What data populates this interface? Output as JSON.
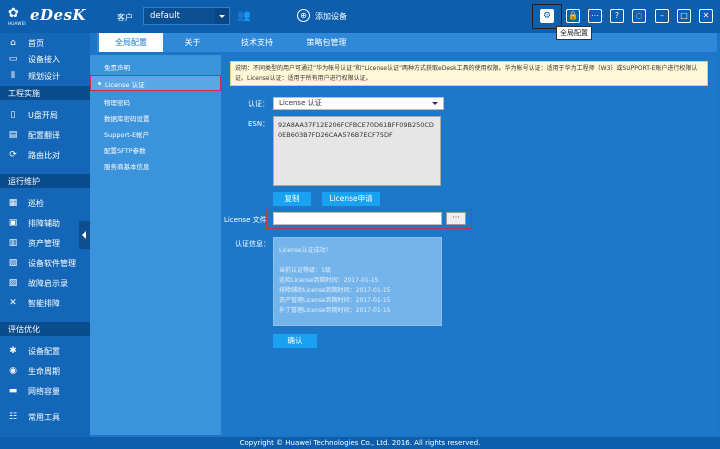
{
  "header": {
    "brand_sub": "HUAWEI",
    "brand": "eDesK",
    "customer_label": "客户",
    "customer_value": "default",
    "add_device": "添加设备",
    "tooltip": "全局配置",
    "help_label": "?"
  },
  "sidebar": {
    "items": [
      {
        "label": "首页",
        "icon": "home-icon"
      },
      {
        "label": "设备接入",
        "icon": "device-access-icon"
      },
      {
        "label": "规划设计",
        "icon": "plan-icon"
      }
    ],
    "sections": [
      "工程实施",
      "运行维护",
      "评估优化"
    ],
    "impl_items": [
      "U盘开局",
      "配置翻译",
      "路由比对"
    ],
    "ops_items": [
      "巡检",
      "排障辅助",
      "资产管理",
      "设备软件管理",
      "故障启示录",
      "智能排障"
    ],
    "opt_items": [
      "设备配置",
      "生命周期",
      "网络容量"
    ],
    "tools": "常用工具"
  },
  "tabs": [
    "全局配置",
    "关于",
    "技术支持",
    "策略包管理"
  ],
  "submenu": [
    "免责声明",
    "License 认证",
    "License 认证",
    "物理密码",
    "数据库密码设置",
    "Support-E帐户",
    "配置SFTP参数",
    "服务商基本信息"
  ],
  "main": {
    "note": "说明：不同类型的用户可通过“华为帐号认证”和“License认证”两种方式获取eDesk工具的使用权限。华为帐号认证：适用于华为工程师（W3）或SUPPORT-E账户进行权限认证。License认证：适用于所有用户进行权限认证。",
    "auth_label": "认证：",
    "auth_value": "License 认证",
    "esn_label": "ESN：",
    "esn_value": "92A8AA37F12E206FCFBCE70D61BFF09B250CD0EB603B7FD26CAA576B7ECF75DF",
    "copy_button": "复制",
    "apply_button": "License申请",
    "file_label": "License 文件",
    "browse_button": "···",
    "info_label": "认证信息：",
    "result_lines": [
      "License认证成功！",
      "",
      "当前认证等级：1级",
      "巡检License到期时间：2017-01-15",
      "排障辅助License到期时间：2017-01-15",
      "资产管理License到期时间：2017-01-15",
      "补丁管理License到期时间：2017-01-15"
    ],
    "confirm_button": "确认"
  },
  "footer": "Copyright © Huawei Technologies Co., Ltd. 2016. All rights reserved."
}
